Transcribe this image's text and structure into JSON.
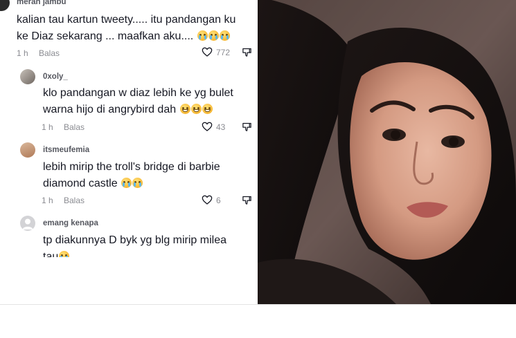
{
  "comments": [
    {
      "username": "merah jambu",
      "lines": [
        "kalian tau kartun tweety..... itu pandangan ku",
        "ke Diaz sekarang ... maafkan aku.... 😭😭😭"
      ],
      "time": "1 h",
      "reply_label": "Balas",
      "likes": "772"
    },
    {
      "username": "0xoly_",
      "lines": [
        "klo pandangan w diaz lebih ke yg bulet",
        "warna hijo di angrybird dah 😅😅😅"
      ],
      "time": "1 h",
      "reply_label": "Balas",
      "likes": "43"
    },
    {
      "username": "itsmeufemia",
      "lines": [
        "lebih mirip the troll's bridge di barbie",
        "diamond castle 😭😭"
      ],
      "time": "1 h",
      "reply_label": "Balas",
      "likes": "6"
    },
    {
      "username": "emang kenapa",
      "lines": [
        "tp diakunnya D byk yg blg mirip milea",
        "tau😭"
      ]
    }
  ],
  "icons": {
    "like": "heart-outline-icon",
    "dislike": "thumbs-down-icon",
    "default_avatar": "default-avatar-icon"
  },
  "colors": {
    "text": "#161823",
    "meta": "#8a8b91",
    "username": "#55575f",
    "emoji": "#f7b733"
  }
}
